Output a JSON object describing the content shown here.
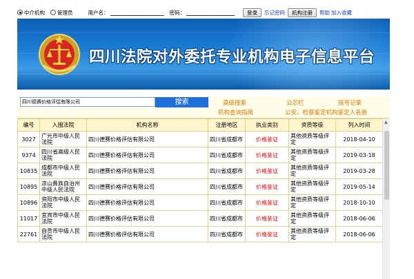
{
  "login": {
    "radio_agency": "中介机构",
    "radio_admin": "管理员",
    "username_label": "用户名：",
    "password_label": "密码：",
    "login_button": "登录",
    "forgot_password": "忘记密码",
    "register_button": "机构注册",
    "help": "帮助",
    "add_favorite": "加入收藏"
  },
  "banner": {
    "title": "四川法院对外委托专业机构电子信息平台"
  },
  "search": {
    "value": "四川德赛价格评估有限公司",
    "button": "搜索"
  },
  "links": {
    "advanced_search": "高级搜索",
    "bulletin": "公示栏",
    "queue_record": "摇号记录",
    "guide": "机构查询指南",
    "public_security": "公安、检察鉴定机构鉴定人名册"
  },
  "table": {
    "headers": [
      "编号",
      "入围法院",
      "机构名称",
      "注册地区",
      "执业类别",
      "资质等级",
      "列入时间"
    ],
    "rows": [
      {
        "id": "3027",
        "court": "广元市中级人民法院",
        "name": "四川德赛价格评估有限公司",
        "region": "四川省成都市",
        "category": "价格鉴证",
        "level": "其他资质等级评定",
        "date": "2018-04-10"
      },
      {
        "id": "9374",
        "court": "四川省高级人民法院",
        "name": "四川德赛价格评估有限公司",
        "region": "四川省成都市",
        "category": "价格鉴证",
        "level": "其他资质等级评定",
        "date": "2019-03-18"
      },
      {
        "id": "10835",
        "court": "成都市中级人民法院",
        "name": "四川德赛价格评估有限公司",
        "region": "四川省成都市",
        "category": "价格鉴证",
        "level": "其他资质等级评定",
        "date": "2019-03-28"
      },
      {
        "id": "10895",
        "court": "凉山彝族自治州中级人民法院",
        "name": "四川德赛价格评估有限公司",
        "region": "四川省成都市",
        "category": "价格鉴证",
        "level": "其他资质等级评定",
        "date": "2019-05-14"
      },
      {
        "id": "10896",
        "court": "资阳市中级人民法院",
        "name": "四川德赛价格评估有限公司",
        "region": "四川省成都市",
        "category": "价格鉴证",
        "level": "其他资质等级评定",
        "date": "2018-10-10"
      },
      {
        "id": "11017",
        "court": "宜宾市中级人民法院",
        "name": "四川德赛价格评估有限公司",
        "region": "四川省成都市",
        "category": "价格鉴证",
        "level": "其他资质等级评定",
        "date": "2018-06-06"
      },
      {
        "id": "22761",
        "court": "自贡市中级人民法院",
        "name": "四川德赛价格评估有限公司",
        "region": "四川省成都市",
        "category": "价格鉴证",
        "level": "其他资质等级评定",
        "date": "2018-06-06"
      }
    ]
  },
  "colors": {
    "banner_blue": "#1b7fd8",
    "link_orange": "#e07800",
    "category_red": "#e01010",
    "header_yellow": "#fff6cc"
  }
}
